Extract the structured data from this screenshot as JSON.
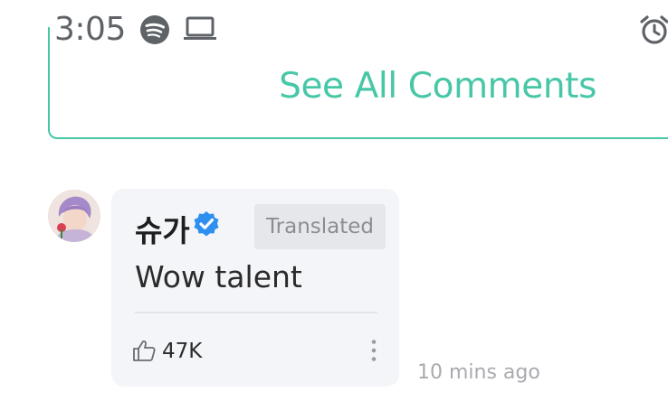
{
  "status_bar": {
    "time": "3:05",
    "icons": [
      "spotify-icon",
      "laptop-icon",
      "alarm-icon"
    ]
  },
  "comments_card": {
    "see_all_label": "See All Comments"
  },
  "comment": {
    "author": "슈가",
    "verified": true,
    "translated_label": "Translated",
    "text": "Wow talent",
    "like_count": "47K",
    "timestamp": "10 mins ago"
  },
  "colors": {
    "accent": "#48c7a7",
    "verified": "#2d8ff0",
    "bubble_bg": "#f4f5f9",
    "muted_text": "#a8aaae"
  }
}
